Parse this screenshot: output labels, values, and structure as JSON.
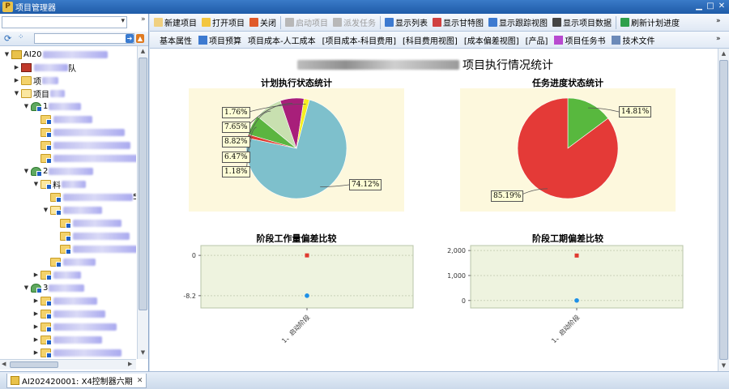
{
  "window": {
    "title": "项目管理器",
    "app_icon": "P"
  },
  "toolbar": {
    "buttons": [
      {
        "label": "新建项目",
        "icon": "new-doc-icon",
        "color": "#f0d080",
        "enabled": true
      },
      {
        "label": "打开项目",
        "icon": "open-folder-icon",
        "color": "#f3c640",
        "enabled": true
      },
      {
        "label": "关闭",
        "icon": "close-scissors-icon",
        "color": "#e05a2a",
        "enabled": true
      },
      {
        "label": "启动项目",
        "icon": "start-icon",
        "color": "#b8b8b8",
        "enabled": false
      },
      {
        "label": "派发任务",
        "icon": "dispatch-icon",
        "color": "#b8b8b8",
        "enabled": false
      },
      {
        "label": "显示列表",
        "icon": "list-icon",
        "color": "#3d7ad0",
        "enabled": true
      },
      {
        "label": "显示甘特图",
        "icon": "gantt-icon",
        "color": "#d04040",
        "enabled": true
      },
      {
        "label": "显示跟踪视图",
        "icon": "track-view-icon",
        "color": "#3d7ad0",
        "enabled": true
      },
      {
        "label": "显示项目数据",
        "icon": "data-icon",
        "color": "#444",
        "enabled": true
      },
      {
        "label": "刷新计划进度",
        "icon": "refresh-icon",
        "color": "#2ea04b",
        "enabled": true
      }
    ]
  },
  "tabs": [
    {
      "label": "基本属性",
      "icon": ""
    },
    {
      "label": "项目预算",
      "icon": "doc-icon"
    },
    {
      "label": "项目成本-人工成本",
      "icon": ""
    },
    {
      "label": "[项目成本-科目费用]",
      "icon": ""
    },
    {
      "label": "[科目费用视图]",
      "icon": ""
    },
    {
      "label": "[成本偏差视图]",
      "icon": ""
    },
    {
      "label": "[产品]",
      "icon": ""
    },
    {
      "label": "项目任务书",
      "icon": "book-icon"
    },
    {
      "label": "技术文件",
      "icon": "file-icon"
    }
  ],
  "tree": {
    "nodes": [
      {
        "depth": 0,
        "toggle": "▼",
        "icon": "logo",
        "label": "AI20",
        "blur": 80
      },
      {
        "depth": 1,
        "toggle": "▶",
        "icon": "gift",
        "label": "",
        "blur": 42,
        "suffix": "队"
      },
      {
        "depth": 1,
        "toggle": "▶",
        "icon": "folder",
        "label": "项",
        "blur": 20
      },
      {
        "depth": 1,
        "toggle": "▼",
        "icon": "folder-open",
        "label": "项目",
        "blur": 18
      },
      {
        "depth": 2,
        "toggle": "▼",
        "icon": "person",
        "label": "1",
        "blur": 40
      },
      {
        "depth": 3,
        "toggle": "",
        "icon": "folder",
        "label": "",
        "blur": 48
      },
      {
        "depth": 3,
        "toggle": "",
        "icon": "folder",
        "label": "",
        "blur": 88
      },
      {
        "depth": 3,
        "toggle": "",
        "icon": "folder",
        "label": "",
        "blur": 95
      },
      {
        "depth": 3,
        "toggle": "",
        "icon": "folder",
        "label": "",
        "blur": 108
      },
      {
        "depth": 2,
        "toggle": "▼",
        "icon": "person",
        "label": "2",
        "blur": 55
      },
      {
        "depth": 3,
        "toggle": "▼",
        "icon": "folder-open",
        "label": "料",
        "blur": 30
      },
      {
        "depth": 4,
        "toggle": "",
        "icon": "folder",
        "label": "",
        "blur": 86,
        "suffix": "5"
      },
      {
        "depth": 4,
        "toggle": "▼",
        "icon": "folder-open",
        "label": "",
        "blur": 48
      },
      {
        "depth": 5,
        "toggle": "",
        "icon": "folder",
        "label": "",
        "blur": 60
      },
      {
        "depth": 5,
        "toggle": "",
        "icon": "folder",
        "label": "",
        "blur": 70
      },
      {
        "depth": 5,
        "toggle": "",
        "icon": "folder",
        "label": "",
        "blur": 80
      },
      {
        "depth": 4,
        "toggle": "",
        "icon": "folder",
        "label": "",
        "blur": 40
      },
      {
        "depth": 3,
        "toggle": "▶",
        "icon": "folder",
        "label": "",
        "blur": 34
      },
      {
        "depth": 2,
        "toggle": "▼",
        "icon": "person",
        "label": "3",
        "blur": 44
      },
      {
        "depth": 3,
        "toggle": "▶",
        "icon": "folder",
        "label": "",
        "blur": 54
      },
      {
        "depth": 3,
        "toggle": "▶",
        "icon": "folder",
        "label": "",
        "blur": 64
      },
      {
        "depth": 3,
        "toggle": "▶",
        "icon": "folder",
        "label": "",
        "blur": 78
      },
      {
        "depth": 3,
        "toggle": "▶",
        "icon": "folder",
        "label": "",
        "blur": 60
      },
      {
        "depth": 3,
        "toggle": "▶",
        "icon": "folder",
        "label": "",
        "blur": 84
      }
    ]
  },
  "page": {
    "title": "项目执行情况统计"
  },
  "charts": {
    "plan_status": {
      "title": "计划执行状态统计",
      "slices": [
        {
          "value": 74.12,
          "label": "74.12%",
          "color": "#7ec0cc"
        },
        {
          "value": 1.18,
          "label": "1.18%",
          "color": "#e03a30"
        },
        {
          "value": 6.47,
          "label": "6.47%",
          "color": "#5bb540"
        },
        {
          "value": 8.82,
          "label": "8.82%",
          "color": "#c8e0b0"
        },
        {
          "value": 7.65,
          "label": "7.65%",
          "color": "#a81f7a"
        },
        {
          "value": 1.76,
          "label": "1.76%",
          "color": "#f6ee20"
        }
      ]
    },
    "task_progress": {
      "title": "任务进度状态统计",
      "slices": [
        {
          "value": 14.81,
          "label": "14.81%",
          "color": "#58b83e"
        },
        {
          "value": 85.19,
          "label": "85.19%",
          "color": "#e43a37"
        }
      ]
    },
    "workload_deviation": {
      "title": "阶段工作量偏差比较",
      "y_ticks": [
        "0",
        "-8.2"
      ],
      "category": "1、启动阶段",
      "series": [
        {
          "value": 0,
          "color": "#e03a30",
          "shape": "square"
        },
        {
          "value": -8.2,
          "color": "#1e90e8",
          "shape": "circle"
        }
      ],
      "ylim": [
        -10.7,
        2
      ]
    },
    "schedule_deviation": {
      "title": "阶段工期偏差比较",
      "y_ticks": [
        "2,000",
        "1,000",
        "0"
      ],
      "category": "1、启动阶段",
      "series": [
        {
          "value": 1800,
          "color": "#e03a30",
          "shape": "square"
        },
        {
          "value": 0,
          "color": "#1e90e8",
          "shape": "circle"
        }
      ],
      "ylim": [
        -300,
        2200
      ]
    }
  },
  "status": {
    "doc_tab_label": "AI202420001: X4控制器六期",
    "doc_tab_close": "✕"
  }
}
